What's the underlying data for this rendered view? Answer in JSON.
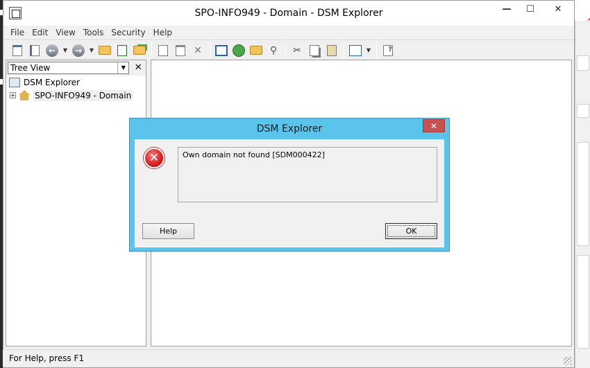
{
  "window": {
    "title": "SPO-INFO949 - Domain - DSM Explorer",
    "minimize": "—",
    "maximize": "☐",
    "close": "✕"
  },
  "menu": [
    "File",
    "Edit",
    "View",
    "Tools",
    "Security",
    "Help"
  ],
  "toolbar": {
    "icons": [
      "show-hide-tree-icon",
      "export-icon",
      "back-icon",
      "forward-icon",
      "up-folder-icon",
      "refresh-icon",
      "new-folder-icon",
      "new-document-icon",
      "properties-icon",
      "delete-icon",
      "details-view-icon",
      "history-icon",
      "open-folder-icon",
      "find-icon",
      "cut-icon",
      "copy-icon",
      "paste-icon",
      "view-options-icon",
      "help-icon"
    ]
  },
  "tree_view": {
    "selector_value": "Tree View",
    "close": "✕",
    "items": [
      {
        "label": "DSM Explorer",
        "icon": "dsm-explorer-icon"
      },
      {
        "label": "SPO-INFO949 - Domain",
        "icon": "domain-house-icon",
        "expander": "+"
      }
    ]
  },
  "status_bar": {
    "text": "For Help, press F1"
  },
  "dialog": {
    "title": "DSM Explorer",
    "close": "✕",
    "message": "Own domain not found [SDM000422]",
    "help_label": "Help",
    "ok_label": "OK",
    "icon": "error-icon",
    "accent_color": "#5bc4ec"
  }
}
